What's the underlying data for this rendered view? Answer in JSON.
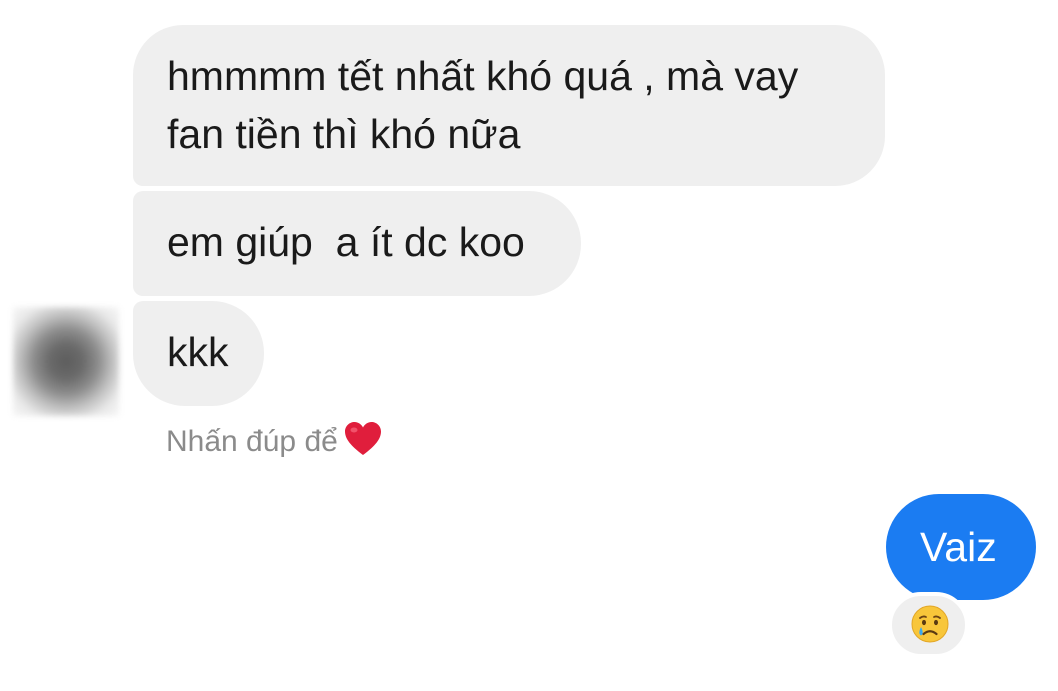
{
  "messages": {
    "incoming": [
      {
        "text": "hmmmm tết nhất khó quá , mà vay\nfan tiền thì khó nữa"
      },
      {
        "text": "em giúp  a ít dc koo"
      },
      {
        "text": "kkk"
      }
    ],
    "outgoing": [
      {
        "text": "Vaiz",
        "reaction_icon": "crying-face-icon"
      }
    ]
  },
  "hint": {
    "text": "Nhấn đúp để",
    "icon": "heart-icon"
  },
  "colors": {
    "incoming_bubble": "#efefef",
    "outgoing_bubble": "#1b7cf2",
    "hint_text": "#8b8b8b",
    "heart": "#e01e3c"
  }
}
